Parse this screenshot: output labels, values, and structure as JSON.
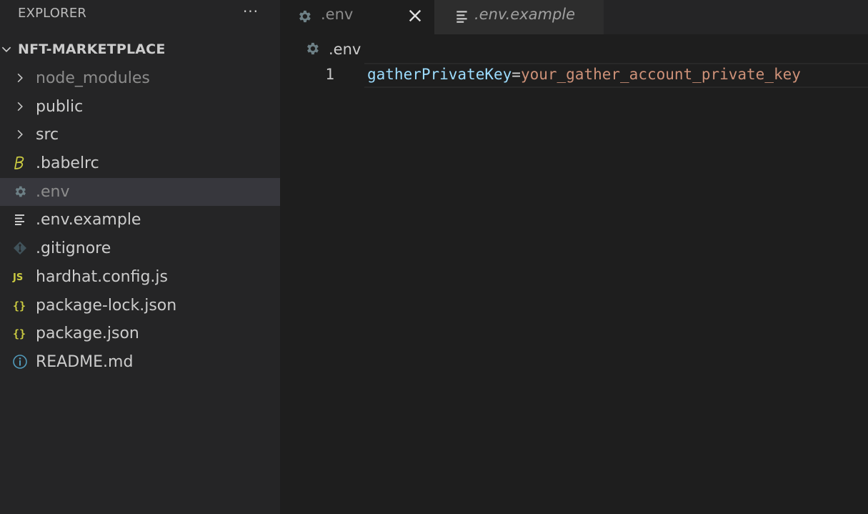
{
  "sidebar": {
    "title": "EXPLORER",
    "more_actions": "···",
    "project": "NFT-MARKETPLACE",
    "items": [
      {
        "label": "node_modules",
        "kind": "folder",
        "icon": "chevron-right-icon"
      },
      {
        "label": "public",
        "kind": "folder",
        "icon": "chevron-right-icon"
      },
      {
        "label": "src",
        "kind": "folder",
        "icon": "chevron-right-icon"
      },
      {
        "label": ".babelrc",
        "kind": "file",
        "icon": "babel-icon"
      },
      {
        "label": ".env",
        "kind": "file",
        "icon": "gear-icon",
        "selected": true
      },
      {
        "label": ".env.example",
        "kind": "file",
        "icon": "lines-icon"
      },
      {
        "label": ".gitignore",
        "kind": "file",
        "icon": "git-icon"
      },
      {
        "label": "hardhat.config.js",
        "kind": "file",
        "icon": "js-icon"
      },
      {
        "label": "package-lock.json",
        "kind": "file",
        "icon": "json-braces-icon"
      },
      {
        "label": "package.json",
        "kind": "file",
        "icon": "json-braces-icon"
      },
      {
        "label": "README.md",
        "kind": "file",
        "icon": "info-icon"
      }
    ]
  },
  "tabs": [
    {
      "label": ".env",
      "icon": "gear-icon",
      "active": true
    },
    {
      "label": ".env.example",
      "icon": "lines-icon",
      "active": false
    }
  ],
  "breadcrumb": {
    "label": ".env",
    "icon": "gear-icon"
  },
  "editor": {
    "line_number": "1",
    "key": "gatherPrivateKey",
    "equals": "=",
    "value": "your_gather_account_private_key"
  },
  "colors": {
    "background": "#1e1e1e",
    "sidebar": "#252526",
    "selected_row": "#37373d",
    "key_token": "#9cdcfe",
    "value_token": "#ce9178",
    "js_yellow": "#cbcb41",
    "info_blue": "#519aba"
  }
}
